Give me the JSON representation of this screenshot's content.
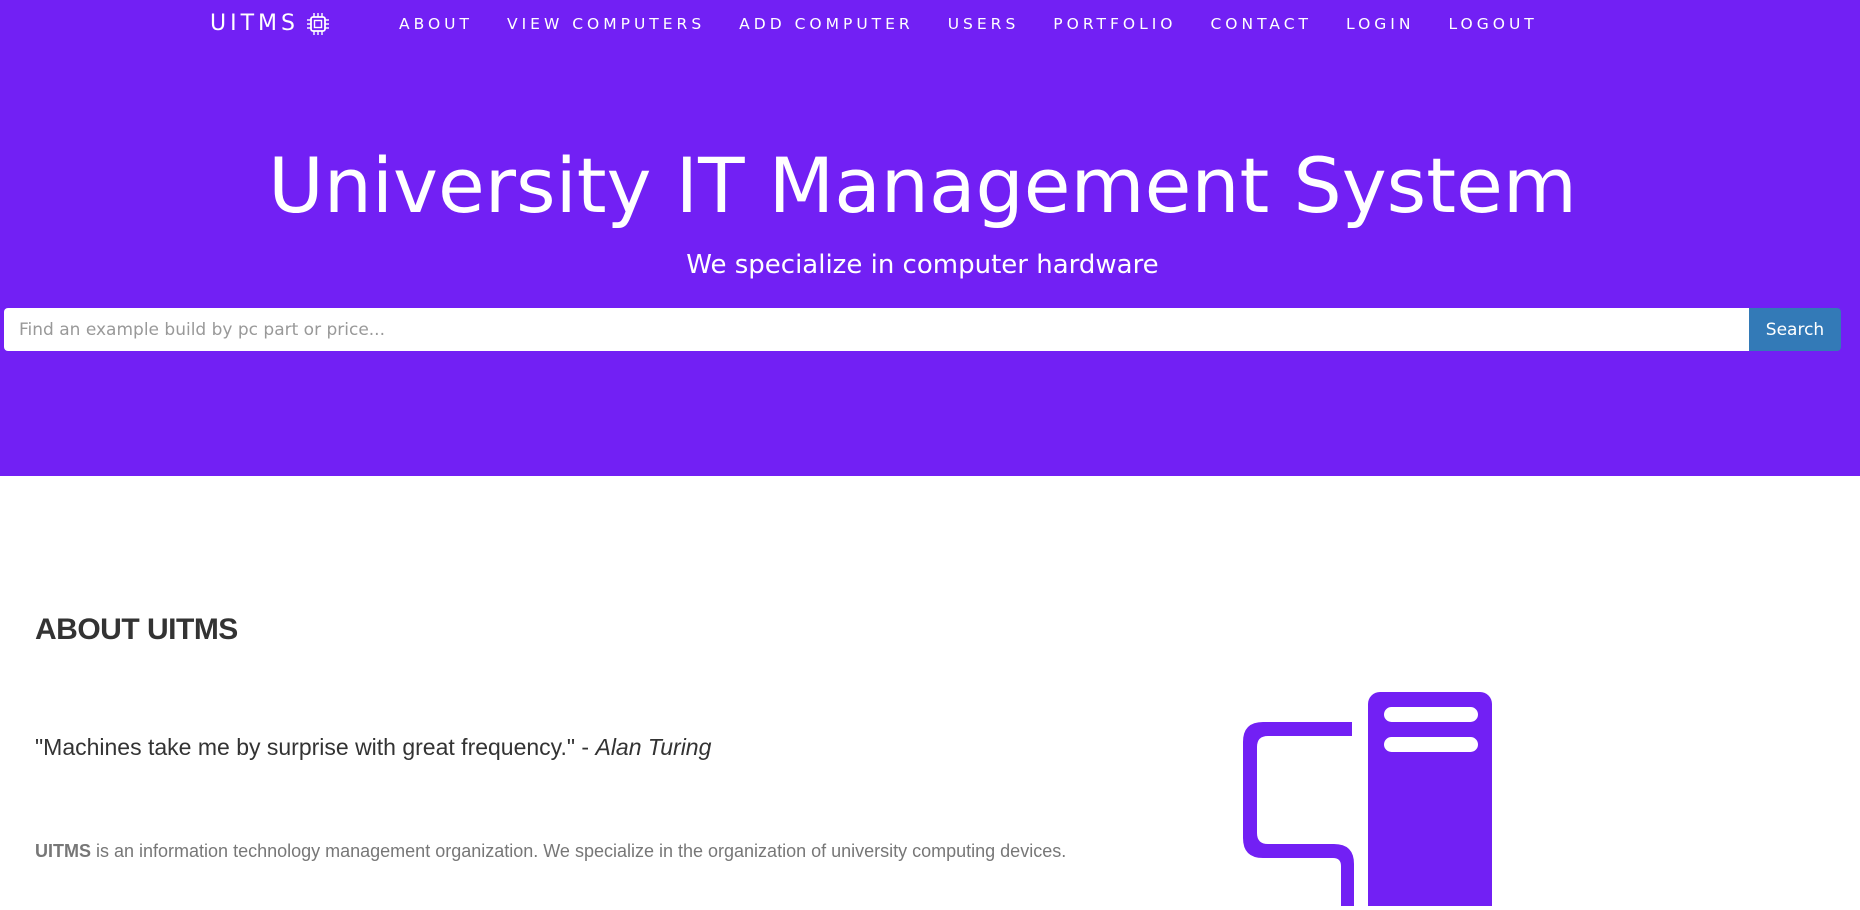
{
  "navbar": {
    "brand": "UITMS",
    "brand_icon": "chip-icon",
    "links": [
      {
        "label": "ABOUT"
      },
      {
        "label": "VIEW COMPUTERS"
      },
      {
        "label": "ADD COMPUTER"
      },
      {
        "label": "USERS"
      },
      {
        "label": "PORTFOLIO"
      },
      {
        "label": "CONTACT"
      },
      {
        "label": "LOGIN"
      },
      {
        "label": "LOGOUT"
      }
    ]
  },
  "hero": {
    "title": "University IT Management System",
    "subtitle": "We specialize in computer hardware",
    "background_color": "#7220f4"
  },
  "search": {
    "placeholder": "Find an example build by pc part or price...",
    "value": "",
    "button_label": "Search",
    "button_color": "#337ab7"
  },
  "about": {
    "heading": "ABOUT UITMS",
    "quote_text": "\"Machines take me by surprise with great frequency.\"",
    "quote_separator": " - ",
    "quote_author": "Alan Turing",
    "description_strong": "UITMS",
    "description_rest": " is an information technology management organization. We specialize in the organization of university computing devices.",
    "illustration_icon": "computer-tower-icon",
    "accent_color": "#7220f4"
  }
}
